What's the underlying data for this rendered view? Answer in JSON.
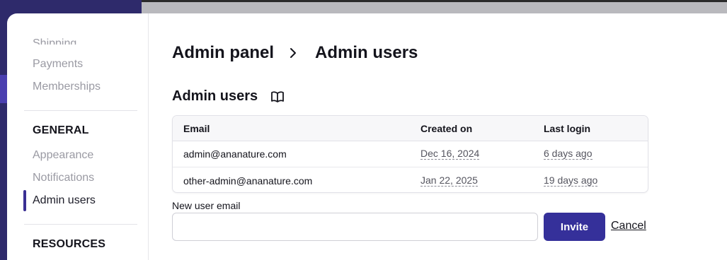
{
  "sidebar": {
    "clipped_item": "Shipping",
    "items_top": [
      {
        "label": "Payments"
      },
      {
        "label": "Memberships"
      }
    ],
    "general_heading": "GENERAL",
    "general_items": [
      {
        "label": "Appearance"
      },
      {
        "label": "Notifications"
      },
      {
        "label": "Admin users",
        "active": true
      }
    ],
    "resources_heading": "RESOURCES"
  },
  "breadcrumb": {
    "root": "Admin panel",
    "current": "Admin users",
    "separator_icon": "chevron-right-icon"
  },
  "section": {
    "title": "Admin users",
    "docs_icon": "book-icon"
  },
  "table": {
    "columns": [
      "Email",
      "Created on",
      "Last login"
    ],
    "rows": [
      {
        "email": "admin@ananature.com",
        "created_on": "Dec 16, 2024",
        "last_login": "6 days ago"
      },
      {
        "email": "other-admin@ananature.com",
        "created_on": "Jan 22, 2025",
        "last_login": "19 days ago"
      }
    ]
  },
  "invite_form": {
    "label": "New user email",
    "value": "",
    "placeholder": "",
    "invite_label": "Invite",
    "cancel_label": "Cancel"
  },
  "colors": {
    "accent": "#35309a",
    "backdrop": "#2e2a6b",
    "muted_text": "#9a9aa3"
  }
}
